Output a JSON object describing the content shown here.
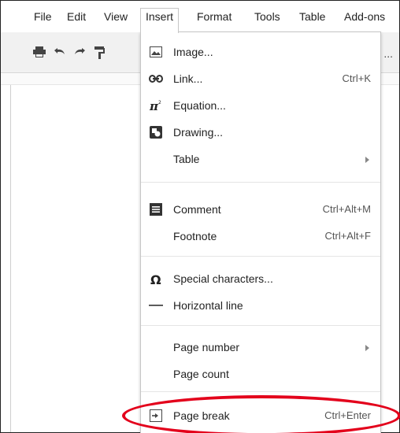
{
  "menubar": {
    "items": [
      "File",
      "Edit",
      "View",
      "Insert",
      "Format",
      "Tools",
      "Table",
      "Add-ons"
    ]
  },
  "toolbar": {
    "buttons": [
      "print-icon",
      "undo-icon",
      "redo-icon",
      "paint-format-icon"
    ],
    "overflow": "..."
  },
  "insert_menu": {
    "items": [
      {
        "label": "Image...",
        "icon": "image-icon"
      },
      {
        "label": "Link...",
        "shortcut": "Ctrl+K",
        "icon": "link-icon"
      },
      {
        "label": "Equation...",
        "icon": "pi-icon"
      },
      {
        "label": "Drawing...",
        "icon": "drawing-icon"
      },
      {
        "label": "Table"
      },
      {
        "label": "Comment",
        "shortcut": "Ctrl+Alt+M",
        "icon": "comment-icon"
      },
      {
        "label": "Footnote",
        "shortcut": "Ctrl+Alt+F"
      },
      {
        "label": "Special characters...",
        "icon": "omega-icon"
      },
      {
        "label": "Horizontal line",
        "icon": "horizontal-line-icon"
      },
      {
        "label": "Page number"
      },
      {
        "label": "Page count"
      },
      {
        "label": "Page break",
        "shortcut": "Ctrl+Enter",
        "icon": "page-break-icon"
      }
    ]
  },
  "annotation": {
    "color": "#e3001b",
    "target": "Page break"
  }
}
